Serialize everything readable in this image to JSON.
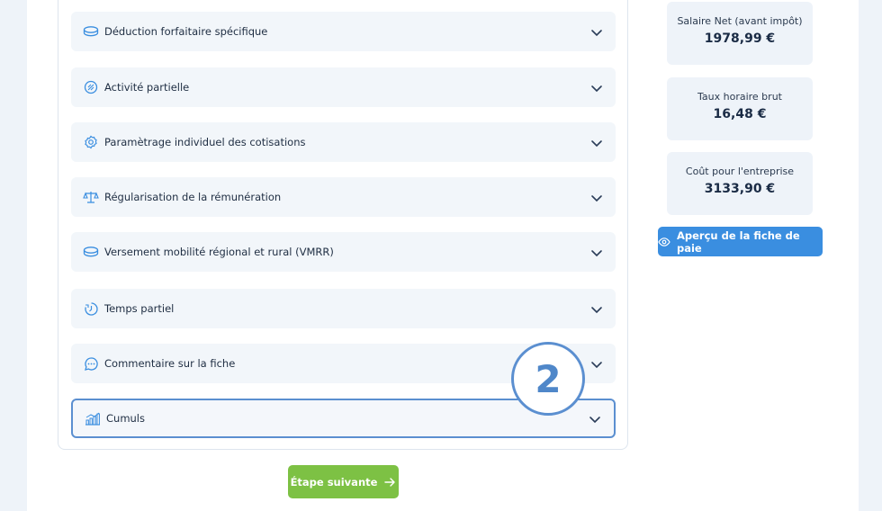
{
  "accordion": [
    {
      "label": "Déduction forfaitaire spécifique",
      "icon": "coin-icon"
    },
    {
      "label": "Activité partielle",
      "icon": "chart-circle-icon"
    },
    {
      "label": "Paramètrage individuel des cotisations",
      "icon": "settings-icon"
    },
    {
      "label": "Régularisation de la rémunération",
      "icon": "scale-icon"
    },
    {
      "label": "Versement mobilité régional et rural (VMRR)",
      "icon": "coin-icon"
    },
    {
      "label": "Temps partiel",
      "icon": "clock-icon"
    },
    {
      "label": "Commentaire sur la fiche",
      "icon": "chat-bubble-icon"
    },
    {
      "label": "Cumuls",
      "icon": "bar-chart-icon"
    }
  ],
  "summary": {
    "net": {
      "label": "Salaire Net (avant impôt)",
      "value": "1978,99 €"
    },
    "hourly": {
      "label": "Taux horaire brut",
      "value": "16,48 €"
    },
    "cost": {
      "label": "Coût pour l'entreprise",
      "value": "3133,90 €"
    }
  },
  "preview_button": {
    "label": "Aperçu de la fiche de paie",
    "icon": "eye-icon"
  },
  "next_button": {
    "label": "Étape suivante",
    "icon": "arrow-right-icon"
  },
  "step_badge": {
    "number": "2"
  },
  "colors": {
    "accent": "#3a8ee0",
    "next": "#7dc144",
    "highlight": "#5b8fd0"
  }
}
